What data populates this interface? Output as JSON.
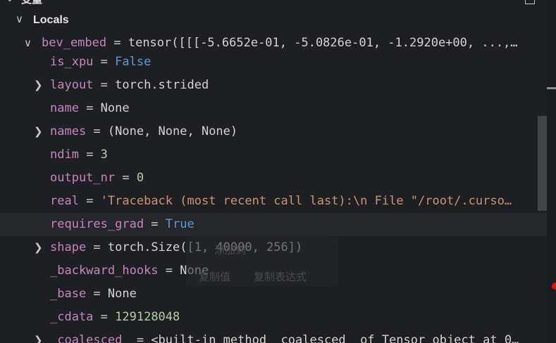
{
  "header": {
    "title": "变量"
  },
  "section": {
    "label": "Locals"
  },
  "rows": [
    {
      "key": "bev_embed",
      "value": "tensor([[[-5.6652e-01, -5.0826e-01, -1.2920e+00,  ...,…",
      "twisty": "v"
    },
    {
      "key": "is_xpu",
      "value": "False",
      "twisty": ""
    },
    {
      "key": "layout",
      "value": "torch.strided",
      "twisty": ">"
    },
    {
      "key": "name",
      "value": "None",
      "twisty": ""
    },
    {
      "key": "names",
      "value": "(None, None, None)",
      "twisty": ">"
    },
    {
      "key": "ndim",
      "value": "3",
      "twisty": ""
    },
    {
      "key": "output_nr",
      "value": "0",
      "twisty": ""
    },
    {
      "key": "real",
      "value": "'Traceback (most recent call last):\\n  File \"/root/.curso…",
      "twisty": ""
    },
    {
      "key": "requires_grad",
      "value": "True",
      "twisty": ""
    },
    {
      "key": "shape",
      "value": "torch.Size([1, 40000, 256])",
      "twisty": ">"
    },
    {
      "key": "_backward_hooks",
      "value": "None",
      "twisty": ""
    },
    {
      "key": "_base",
      "value": "None",
      "twisty": ""
    },
    {
      "key": "_cdata",
      "value": "129128048",
      "twisty": ""
    },
    {
      "key": "_coalesced_",
      "value": "<built-in method _coalesced_ of Tensor object at 0…",
      "twisty": ">"
    }
  ],
  "context_menu": {
    "item1": "添加到",
    "item2": "复制值",
    "item3": "复制表达式"
  },
  "colors": {
    "key": "#c586c0",
    "bool": "#569cd6",
    "number": "#b5cea8",
    "string": "#ce9178",
    "background": "#1e1f22"
  }
}
